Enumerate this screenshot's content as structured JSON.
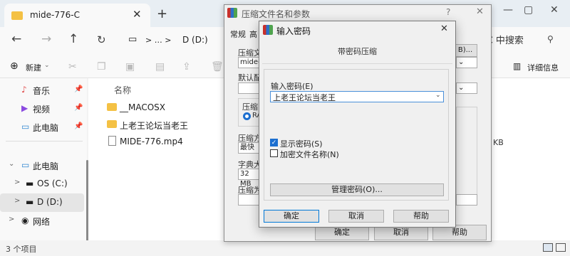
{
  "explorer": {
    "tab_title": "mide-776-C",
    "tab_close": "✕",
    "tab_add": "+",
    "address_icons": ">  …  >",
    "address": "D (D:)",
    "search_text": "-C 中搜索",
    "new_label": "新建",
    "details_label": "详细信息",
    "column_name": "名称",
    "sidebar": [
      {
        "label": "音乐",
        "icon": "♪",
        "color": "#e04a4a",
        "pinned": true
      },
      {
        "label": "视频",
        "icon": "▶",
        "color": "#8b4ae0",
        "pinned": true
      },
      {
        "label": "此电脑",
        "icon": "▭",
        "color": "#2f86d1",
        "pinned": true
      },
      {
        "label": "此电脑",
        "icon": "▭",
        "color": "#2f86d1",
        "chevron": "⌄"
      },
      {
        "label": "OS (C:)",
        "icon": "▬",
        "color": "#2f86d1",
        "chevron": ">"
      },
      {
        "label": "D (D:)",
        "icon": "▬",
        "color": "#555555",
        "chevron": ">",
        "selected": true
      },
      {
        "label": "网络",
        "icon": "◉",
        "color": "#2f86d1",
        "chevron": ">"
      }
    ],
    "files": [
      {
        "name": "__MACOSX",
        "type": "folder"
      },
      {
        "name": "上老王论坛当老王",
        "type": "folder"
      },
      {
        "name": "MIDE-776.mp4",
        "type": "file"
      }
    ],
    "status": "3 个项目"
  },
  "archive_dialog": {
    "title": "压缩文件名和参数",
    "help_q": "?",
    "close": "✕",
    "tabs": [
      "常规",
      "高"
    ],
    "labels": [
      "压缩文",
      "默认配",
      "压缩方",
      "字典大",
      "压缩为"
    ],
    "field_archive": "mide-",
    "browse_button": "B)...",
    "method_label": "压缩方",
    "method_value": "最快",
    "dict_value": "32 MB",
    "format_label": "压缩",
    "format_option": "RA",
    "size_unit": "KB",
    "ok": "确定",
    "cancel": "取消",
    "help": "帮助"
  },
  "password_dialog": {
    "title": "输入密码",
    "close": "✕",
    "subtitle": "带密码压缩",
    "enter_label": "输入密码(E)",
    "password_value": "上老王论坛当老王",
    "show_password": "显示密码(S)",
    "show_password_checked": true,
    "encrypt_names": "加密文件名称(N)",
    "encrypt_names_checked": false,
    "manage_button": "管理密码(O)...",
    "ok": "确定",
    "cancel": "取消",
    "help": "帮助"
  }
}
